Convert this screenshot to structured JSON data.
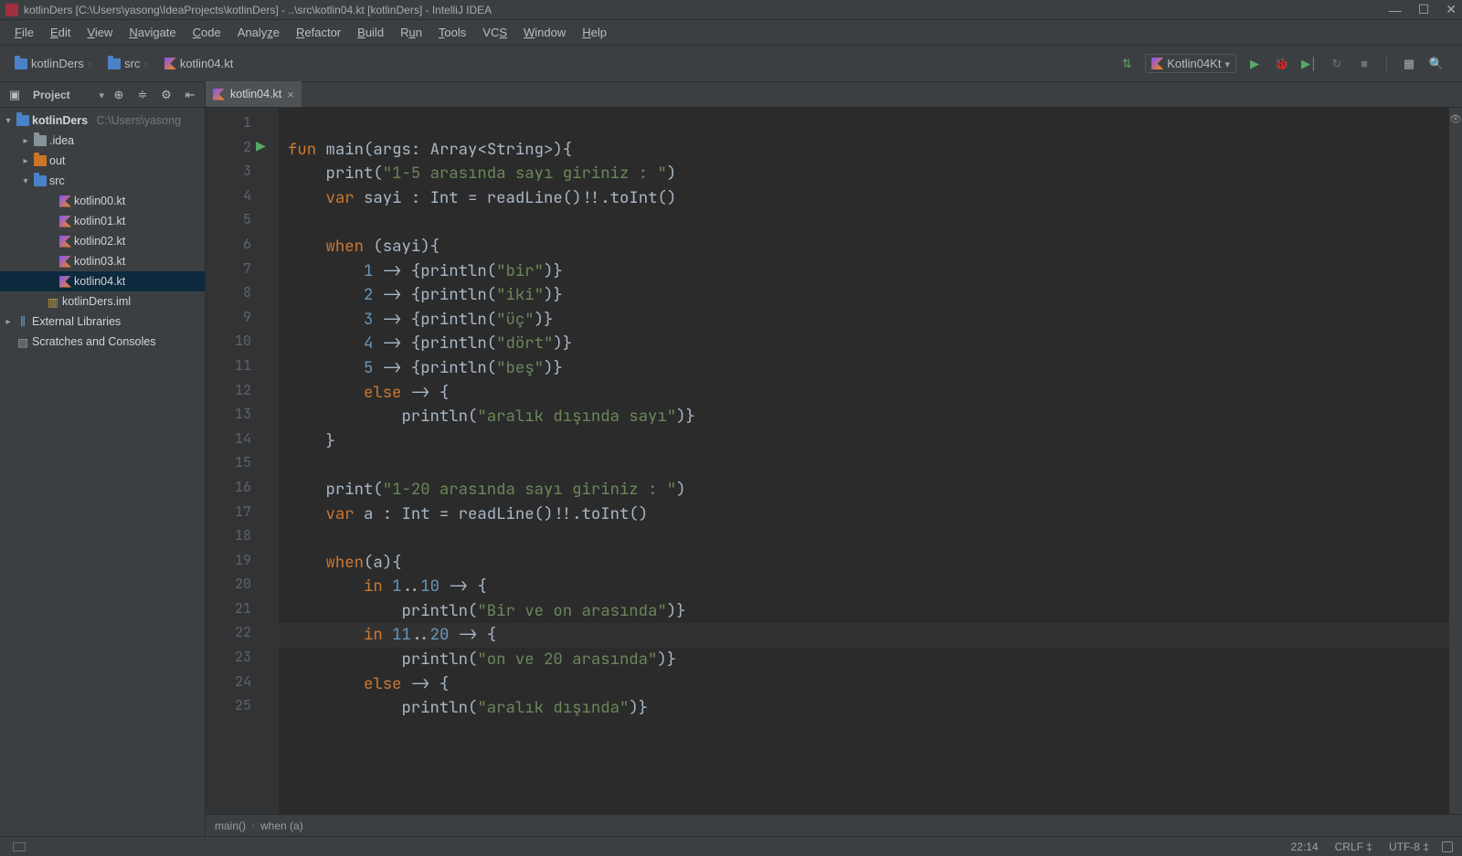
{
  "window": {
    "title": "kotlinDers [C:\\Users\\yasong\\IdeaProjects\\kotlinDers] - ..\\src\\kotlin04.kt [kotlinDers] - IntelliJ IDEA"
  },
  "menu": [
    "File",
    "Edit",
    "View",
    "Navigate",
    "Code",
    "Analyze",
    "Refactor",
    "Build",
    "Run",
    "Tools",
    "VCS",
    "Window",
    "Help"
  ],
  "breadcrumbs": {
    "root": "kotlinDers",
    "src": "src",
    "file": "kotlin04.kt"
  },
  "runconfig": {
    "label": "Kotlin04Kt"
  },
  "projectPanel": {
    "title": "Project"
  },
  "tree": {
    "root": {
      "label": "kotlinDers",
      "path": "C:\\Users\\yasong"
    },
    "idea": ".idea",
    "out": "out",
    "src": "src",
    "files": [
      "kotlin00.kt",
      "kotlin01.kt",
      "kotlin02.kt",
      "kotlin03.kt",
      "kotlin04.kt"
    ],
    "iml": "kotlinDers.iml",
    "ext": "External Libraries",
    "scratches": "Scratches and Consoles"
  },
  "tab": {
    "label": "kotlin04.kt"
  },
  "code": {
    "lines": [
      {
        "n": 1,
        "raw": ""
      },
      {
        "n": 2,
        "raw": "fun main(args: Array<String>){"
      },
      {
        "n": 3,
        "raw": "    print(\"1-5 arasında sayı giriniz : \")"
      },
      {
        "n": 4,
        "raw": "    var sayi : Int = readLine()!!.toInt()"
      },
      {
        "n": 5,
        "raw": ""
      },
      {
        "n": 6,
        "raw": "    when (sayi){"
      },
      {
        "n": 7,
        "raw": "        1 -> {println(\"bir\")}"
      },
      {
        "n": 8,
        "raw": "        2 -> {println(\"iki\")}"
      },
      {
        "n": 9,
        "raw": "        3 -> {println(\"üç\")}"
      },
      {
        "n": 10,
        "raw": "        4 -> {println(\"dört\")}"
      },
      {
        "n": 11,
        "raw": "        5 -> {println(\"beş\")}"
      },
      {
        "n": 12,
        "raw": "        else -> {"
      },
      {
        "n": 13,
        "raw": "            println(\"aralık dışında sayı\")}"
      },
      {
        "n": 14,
        "raw": "    }"
      },
      {
        "n": 15,
        "raw": ""
      },
      {
        "n": 16,
        "raw": "    print(\"1-20 arasında sayı giriniz : \")"
      },
      {
        "n": 17,
        "raw": "    var a : Int = readLine()!!.toInt()"
      },
      {
        "n": 18,
        "raw": ""
      },
      {
        "n": 19,
        "raw": "    when(a){"
      },
      {
        "n": 20,
        "raw": "        in 1..10 -> {"
      },
      {
        "n": 21,
        "raw": "            println(\"Bir ve on arasında\")}"
      },
      {
        "n": 22,
        "raw": "        in 11..20 -> {"
      },
      {
        "n": 23,
        "raw": "            println(\"on ve 20 arasında\")}"
      },
      {
        "n": 24,
        "raw": "        else -> {"
      },
      {
        "n": 25,
        "raw": "            println(\"aralık dışında\")}"
      }
    ],
    "currentLine": 22
  },
  "editorFooter": {
    "scope1": "main()",
    "scope2": "when (a)"
  },
  "status": {
    "pos": "22:14",
    "eol": "CRLF",
    "enc": "UTF-8"
  }
}
